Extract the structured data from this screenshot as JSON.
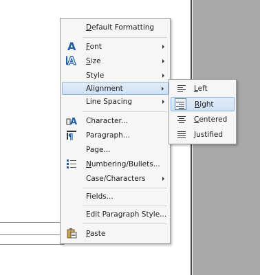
{
  "context_menu": {
    "items": [
      {
        "text": "Default Formatting",
        "ul": "D",
        "rest": "efault Formatting"
      },
      {
        "text": "Font",
        "ul": "F",
        "rest": "ont"
      },
      {
        "text": "Size",
        "ul": "S",
        "rest": "ize"
      },
      {
        "text": "Style",
        "ul": "",
        "rest": "Style"
      },
      {
        "text": "Alignment",
        "ul": "",
        "rest": "Alignment"
      },
      {
        "text": "Line Spacing",
        "ul": "",
        "rest": "Line Spacing"
      },
      {
        "text": "Character...",
        "ul": "",
        "rest": "Character..."
      },
      {
        "text": "Paragraph...",
        "ul": "",
        "rest": "Paragraph..."
      },
      {
        "text": "Page...",
        "ul": "",
        "rest": "Page..."
      },
      {
        "text": "Numbering/Bullets...",
        "ul": "N",
        "rest": "umbering/Bullets..."
      },
      {
        "text": "Case/Characters",
        "ul": "",
        "rest": "Case/Characters"
      },
      {
        "text": "Fields...",
        "ul": "",
        "rest": "Fields..."
      },
      {
        "text": "Edit Paragraph Style...",
        "ul": "",
        "rest": "Edit Paragraph Style..."
      },
      {
        "text": "Paste",
        "ul": "P",
        "rest": "aste"
      }
    ]
  },
  "alignment_submenu": {
    "items": [
      {
        "text": "Left",
        "ul": "L",
        "rest": "eft"
      },
      {
        "text": "Right",
        "ul": "R",
        "rest": "ight"
      },
      {
        "text": "Centered",
        "ul": "C",
        "rest": "entered"
      },
      {
        "text": "Justified",
        "ul": "J",
        "rest": "ustified"
      }
    ]
  },
  "colors": {
    "highlight": "#cfe0f4",
    "highlight_border": "#8fb4e0",
    "icon_blue": "#1f5fa8",
    "gray_area": "#a9a9a9"
  }
}
